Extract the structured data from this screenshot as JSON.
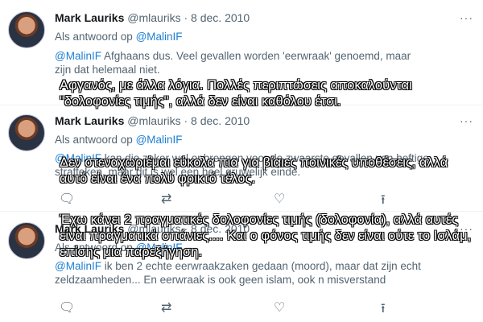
{
  "tweets": [
    {
      "name": "Mark Lauriks",
      "meta": "@mlauriks · 8 dec. 2010",
      "reply_prefix": "Als antwoord op",
      "reply_to": "@MalinIF",
      "mention": "@MalinIF",
      "text_line1": " Afghaans dus. Veel gevallen worden 'eerwraak' genoemd, maar",
      "text_line2": "zijn dat helemaal niet.",
      "more": "···"
    },
    {
      "name": "Mark Lauriks",
      "meta": "@mlauriks · 8 dec. 2010",
      "reply_prefix": "Als antwoord op",
      "reply_to": "@MalinIF",
      "mention": "@MalinIF",
      "text_line1": " kan die zeker wel opbrengen voor de zwaarste gevallen van heftige",
      "text_line2": "straffeken, maar dit is wel een heel gruwelijk einde.",
      "more": "···"
    },
    {
      "name": "Mark Lauriks",
      "meta": "@mlauriks · 8 dec. 2010",
      "reply_prefix": "Als antwoord op",
      "reply_to": "@MalinIF",
      "mention": "@MalinIF",
      "text_line1": " ik ben 2 echte eerwraakzaken gedaan (moord), maar dat zijn echt",
      "text_line2": "zeldzaamheden... En eerwraak is ook geen islam,  ook n misverstand",
      "more": "···"
    }
  ],
  "icons": {
    "reply": "reply-icon",
    "retweet": "retweet-icon",
    "like": "heart-icon",
    "share": "share-icon"
  },
  "captions": [
    "Αφγανός, με άλλα λόγια. Πολλές περιπτώσεις αποκαλούνται \"δολοφονίες τιμής\", αλλά δεν είναι καθόλου έτσι.",
    "Δεν στεναχωριέμαι εύκολα πια για βίαιες ποινικές υποθέσεις, αλλά αυτό είναι ένα πολύ φρικτό τέλος.",
    "Έχω κάνει 2 πραγματικές δολοφονίες τιμής (δολοφονία), αλλά αυτές είναι πραγματικά σπάνιες.... Και ο φόνος τιμής δεν είναι ούτε το Ισλάμ, επίσης μια παρεξήγηση."
  ],
  "colors": {
    "link": "#1d7fd2",
    "muted": "#536471",
    "caption": "#ffffff"
  }
}
